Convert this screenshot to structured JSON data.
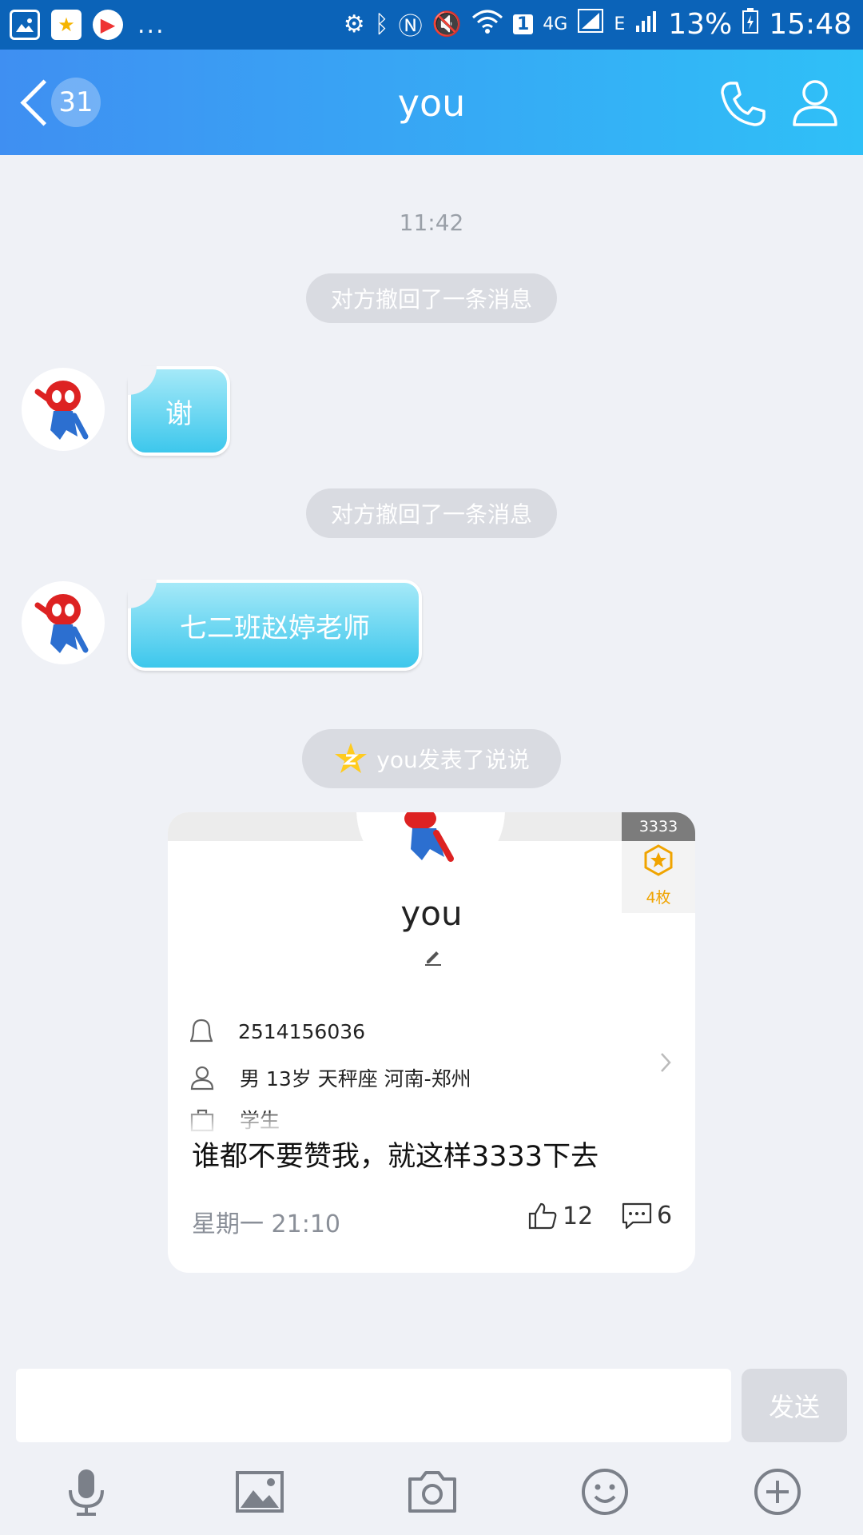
{
  "status_bar": {
    "left_ellipsis": "...",
    "network_4g": "4G",
    "network_e": "E",
    "battery": "13%",
    "clock": "15:48",
    "sim_badge": "1"
  },
  "header": {
    "unread_count": "31",
    "title": "you"
  },
  "chat": {
    "timestamp": "11:42",
    "recall_notice_1": "对方撤回了一条消息",
    "message_1": "谢",
    "recall_notice_2": "对方撤回了一条消息",
    "message_2": "七二班赵婷老师",
    "qzone_notice": "you发表了说说"
  },
  "card": {
    "medal_count": "3333",
    "medal_label": "4枚",
    "name": "you",
    "qq_number": "2514156036",
    "profile_line": "男  13岁  天秤座  河南-郑州",
    "occupation": "学生",
    "post_text": "谁都不要赞我，就这样3333下去",
    "post_time": "星期一 21:10",
    "likes": "12",
    "comments": "6"
  },
  "input_bar": {
    "placeholder": "",
    "send_label": "发送"
  },
  "colors": {
    "header_gradient_start": "#3f8ff2",
    "header_gradient_end": "#2fc0f7",
    "bubble": "#3dc7ec",
    "background": "#eff1f6"
  },
  "icons": [
    "back-icon",
    "phone-icon",
    "person-icon",
    "mic-icon",
    "image-icon",
    "camera-icon",
    "emoji-icon",
    "plus-icon"
  ]
}
